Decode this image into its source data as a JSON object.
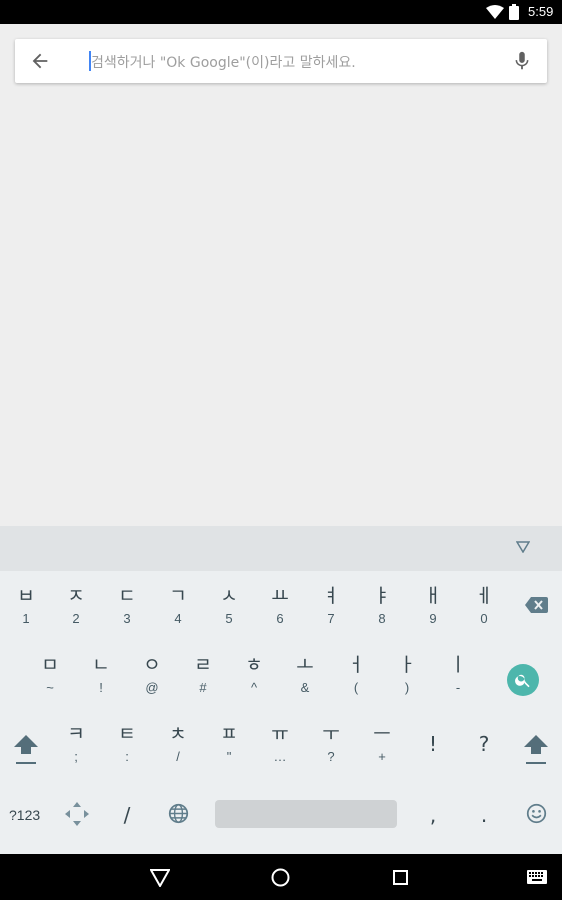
{
  "status_bar": {
    "time": "5:59",
    "icons": [
      "wifi-icon",
      "battery-icon"
    ]
  },
  "search": {
    "placeholder": "검색하거나 \"Ok Google\"(이)라고 말하세요.",
    "icons": [
      "back-arrow-icon",
      "mic-icon"
    ]
  },
  "keyboard": {
    "row1": [
      {
        "main": "ㅂ",
        "sub": "1"
      },
      {
        "main": "ㅈ",
        "sub": "2"
      },
      {
        "main": "ㄷ",
        "sub": "3"
      },
      {
        "main": "ㄱ",
        "sub": "4"
      },
      {
        "main": "ㅅ",
        "sub": "5"
      },
      {
        "main": "ㅛ",
        "sub": "6"
      },
      {
        "main": "ㅕ",
        "sub": "7"
      },
      {
        "main": "ㅑ",
        "sub": "8"
      },
      {
        "main": "ㅐ",
        "sub": "9"
      },
      {
        "main": "ㅔ",
        "sub": "0"
      }
    ],
    "row2": [
      {
        "main": "ㅁ",
        "sub": "~"
      },
      {
        "main": "ㄴ",
        "sub": "!"
      },
      {
        "main": "ㅇ",
        "sub": "@"
      },
      {
        "main": "ㄹ",
        "sub": "#"
      },
      {
        "main": "ㅎ",
        "sub": "^"
      },
      {
        "main": "ㅗ",
        "sub": "&"
      },
      {
        "main": "ㅓ",
        "sub": "("
      },
      {
        "main": "ㅏ",
        "sub": ")"
      },
      {
        "main": "ㅣ",
        "sub": "-"
      }
    ],
    "row3": [
      {
        "main": "ㅋ",
        "sub": ";"
      },
      {
        "main": "ㅌ",
        "sub": ":"
      },
      {
        "main": "ㅊ",
        "sub": "/"
      },
      {
        "main": "ㅍ",
        "sub": "\""
      },
      {
        "main": "ㅠ",
        "sub": "…"
      },
      {
        "main": "ㅜ",
        "sub": "?"
      },
      {
        "main": "ㅡ",
        "sub": "+"
      },
      {
        "main": "!",
        "sub": ""
      },
      {
        "main": "?",
        "sub": ""
      }
    ],
    "row4": {
      "symbols_label": "?123",
      "slash": "/",
      "comma": ",",
      "period": "."
    },
    "accent_color": "#4db6ac"
  },
  "nav_bar": {
    "icons": [
      "back-icon",
      "home-icon",
      "recents-icon",
      "keyboard-icon"
    ]
  }
}
